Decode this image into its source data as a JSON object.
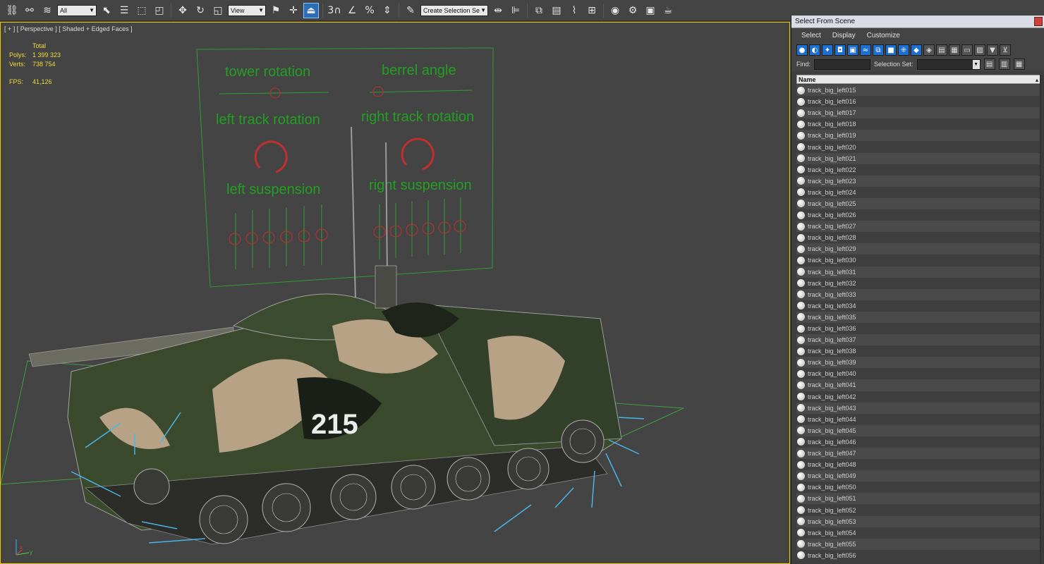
{
  "toolbar": {
    "filter_dropdown": "All",
    "coord_dropdown": "View",
    "snap_label": "3",
    "selection_set": "Create Selection Se"
  },
  "viewport": {
    "label": "[ + ] [ Perspective ] [ Shaded + Edged Faces ]",
    "stats": {
      "total": "Total",
      "polys_label": "Polys:",
      "polys": "1 399 323",
      "verts_label": "Verts:",
      "verts": "738 754",
      "fps_label": "FPS:",
      "fps": "41,126"
    },
    "board": {
      "tower": "tower rotation",
      "barrel": "berrel angle",
      "left_track": "left track rotation",
      "right_track": "right track rotation",
      "left_susp": "left suspension",
      "right_susp": "right suspension"
    },
    "hull_number": "215",
    "axis": {
      "x": "x",
      "y": "y"
    }
  },
  "explorer": {
    "title": "Select From Scene",
    "menu": [
      "Select",
      "Display",
      "Customize"
    ],
    "find_label": "Find:",
    "selection_set_label": "Selection Set:",
    "column_name": "Name",
    "items": [
      "track_big_left015",
      "track_big_left016",
      "track_big_left017",
      "track_big_left018",
      "track_big_left019",
      "track_big_left020",
      "track_big_left021",
      "track_big_left022",
      "track_big_left023",
      "track_big_left024",
      "track_big_left025",
      "track_big_left026",
      "track_big_left027",
      "track_big_left028",
      "track_big_left029",
      "track_big_left030",
      "track_big_left031",
      "track_big_left032",
      "track_big_left033",
      "track_big_left034",
      "track_big_left035",
      "track_big_left036",
      "track_big_left037",
      "track_big_left038",
      "track_big_left039",
      "track_big_left040",
      "track_big_left041",
      "track_big_left042",
      "track_big_left043",
      "track_big_left044",
      "track_big_left045",
      "track_big_left046",
      "track_big_left047",
      "track_big_left048",
      "track_big_left049",
      "track_big_left050",
      "track_big_left051",
      "track_big_left052",
      "track_big_left053",
      "track_big_left054",
      "track_big_left055",
      "track_big_left056"
    ]
  }
}
